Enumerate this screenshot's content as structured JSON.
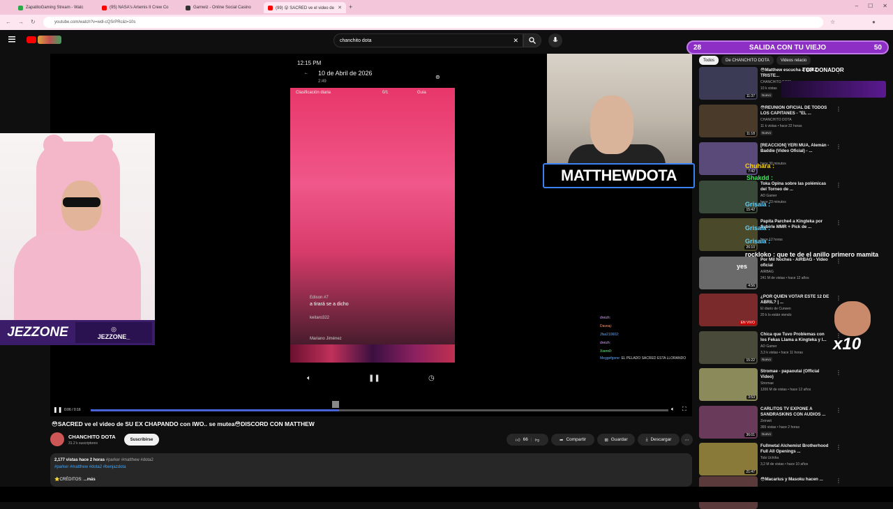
{
  "browser": {
    "tabs": [
      {
        "label": "ZapatitoGaming Stream - Watc",
        "color": "#2ba84a"
      },
      {
        "label": "(95) NASA's Artemis II Crew Co",
        "color": "#ff0000"
      },
      {
        "label": "Gamwiz - Online Social Casino",
        "color": "#333333"
      },
      {
        "label": "(99) 😮 SACRED ve el video de",
        "color": "#ff0000"
      }
    ],
    "url": "youtube.com/watch?v=wdl-cQSrPRc&t=10s"
  },
  "youtube": {
    "search_value": "chanchito dota"
  },
  "player": {
    "phone_time": "12:15 PM",
    "phone_date": "10 de Abril de 2026",
    "phone_sub": "2:49",
    "phone_tab_left": "Clasificación diaria",
    "phone_tab_mid": "0/1",
    "phone_tab_right": "Guia",
    "phone_comment_user": "Edison #7",
    "phone_comment_text": "a tirará se a dicho",
    "phone_comment_user2": "keitaro322",
    "phone_comment_user3": "Mariano Jiménez",
    "webcam_name": "MATTHEWDOTA",
    "time_display": "0:06 / 0:16",
    "progress": 0.43,
    "chat": [
      {
        "user": "dreizh:",
        "text": ""
      },
      {
        "user": "Daveaj:",
        "text": ""
      },
      {
        "user": "Jfas210602:",
        "text": ""
      },
      {
        "user": "dreizh:",
        "text": ""
      },
      {
        "user": "Xxero0:",
        "text": ""
      },
      {
        "user": "Meggefgone:",
        "text": "EL PELADO SACRED ESTA LLORANDO"
      }
    ]
  },
  "streamer": {
    "name": "JEZZONE",
    "handle": "JEZZONE_"
  },
  "video": {
    "title": "😳SACRED ve el video de SU EX CHAPANDO con IWO.. se mutea😳DISCORD CON MATTHEW",
    "channel": "CHANCHITO DOTA",
    "subscribers": "31.2 k suscriptores",
    "subscribe_label": "Suscribirse",
    "likes": "66",
    "share_label": "Compartir",
    "save_label": "Guardar",
    "download_label": "Descargar",
    "views": "2,177 vistas",
    "age": "hace 2 horas",
    "tags1": "#parker #matthew #dota2",
    "tags2": "#parker #matthew #dota2 #benjazdota",
    "credits": "⭐CRÉDITOS:",
    "more": "...más"
  },
  "overlay": {
    "goal_left": "28",
    "goal_text": "SALIDA CON TU VIEJO",
    "goal_right": "50",
    "top_donor": "TOP DONADOR",
    "chat_lines": [
      {
        "text": "Chuhara :",
        "color": "#ffd400"
      },
      {
        "text": "Shakdd :",
        "color": "#3ee85a"
      },
      {
        "text": "Grisaia :",
        "color": "#5fd3ff"
      },
      {
        "text": "Grisaia :",
        "color": "#5fd3ff"
      },
      {
        "text": "Grisaia :",
        "color": "#5fd3ff"
      },
      {
        "text": "rockloko : que te de el anillo primero mamita",
        "color": "#ffffff"
      },
      {
        "text": "yes",
        "color": "#ffffff"
      }
    ],
    "x10": "x10"
  },
  "sidebar": {
    "chips": [
      "Todos",
      "De CHANCHITO DOTA",
      "Videos relacio"
    ],
    "items": [
      {
        "title": "😳Matthew escucha a SOEZ TRISTE...",
        "channel": "CHANCHITO DOTA",
        "meta": "10 k vistas",
        "badge": "Nuevo",
        "duration": "11:37",
        "thumb": "#3b3b56"
      },
      {
        "title": "😳REUNIÓN OFICIAL DE TODOS LOS CAPITANES - \"EL ...",
        "channel": "CHANCHITO DOTA",
        "meta": "11 k vistas • hace 22 horas",
        "badge": "Nuevo",
        "duration": "11:18",
        "thumb": "#4a3a2a"
      },
      {
        "title": "[REACCION] YERI MUA, Alemán - Baddie (Video Oficial) - ...",
        "channel": "",
        "meta": "hace 30 minutos",
        "badge": "",
        "duration": "7:42",
        "thumb": "#5a4a7a"
      },
      {
        "title": "Toka Opina sobre las polémicas del Torneo de ...",
        "channel": "AD Gamer",
        "meta": "hace 23 minutos",
        "badge": "",
        "duration": "15:42",
        "thumb": "#3a4a3a"
      },
      {
        "title": "Papita Parche4 a Kingteka por Subirle MMR + Pick de ...",
        "channel": "",
        "meta": "hace 12 horas",
        "badge": "",
        "duration": "26:10",
        "thumb": "#4a4a2a"
      },
      {
        "title": "Por Mil Noches - AIRBAG - Video oficial",
        "channel": "AIRBAG",
        "meta": "241 M de vistas • hace 12 años",
        "badge": "",
        "duration": "4:56",
        "thumb": "#6a6a6a"
      },
      {
        "title": "¿POR QUIÉN VOTAR ESTE 12 DE ABRIL? | ...",
        "channel": "El diario de Curwen",
        "meta": "20 k lo están viendo",
        "badge": "",
        "duration": "EN VIVO",
        "thumb": "#7a2a2a"
      },
      {
        "title": "Chica que Tuvo Problemas con los Fekas Llama a Kingteka y l...",
        "channel": "AD Gamer",
        "meta": "3,3 k vistas • hace 11 horas",
        "badge": "Nuevo",
        "duration": "15:22",
        "thumb": "#4a4a3a"
      },
      {
        "title": "Stromae - papaoutai (Official Video)",
        "channel": "Stromae",
        "meta": "1206 M de vistas • hace 12 años",
        "badge": "",
        "duration": "3:53",
        "thumb": "#8a8a5a"
      },
      {
        "title": "CARLITOS TV EXPONE A SANDRASKINS CON AUDIOS ...",
        "channel": "Zeinwit",
        "meta": "365 vistas • hace 2 horas",
        "badge": "Nuevo",
        "duration": "36:01",
        "thumb": "#6a3a5a"
      },
      {
        "title": "Fullmetal Alchemist Brotherhood Full All Openings ...",
        "channel": "Tobi Uchiha",
        "meta": "3,2 M de vistas • hace 10 años",
        "badge": "",
        "duration": "21:47",
        "thumb": "#8a7a3a"
      },
      {
        "title": "😳Macarius y Masoku hacen ...",
        "channel": "",
        "meta": "",
        "badge": "",
        "duration": "",
        "thumb": "#5a3a3a"
      }
    ]
  }
}
